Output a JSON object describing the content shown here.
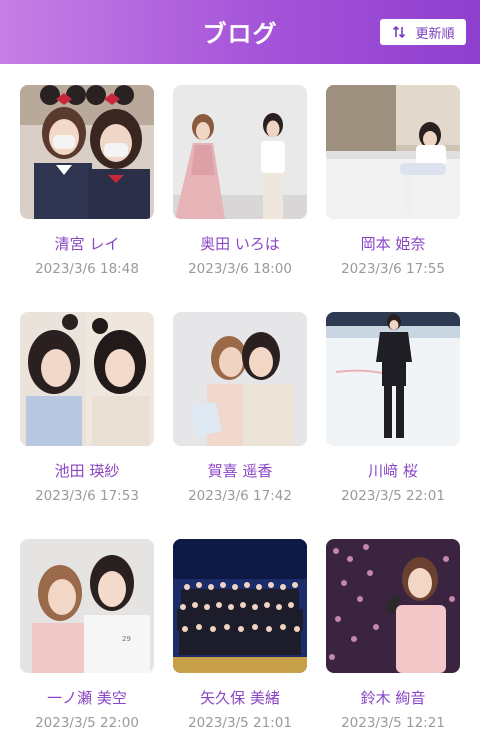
{
  "header": {
    "title": "ブログ",
    "sort_label": "更新順",
    "accent": "#a454d8"
  },
  "posts": [
    {
      "author": "清宮 レイ",
      "date": "2023/3/6 18:48"
    },
    {
      "author": "奥田 いろは",
      "date": "2023/3/6 18:00"
    },
    {
      "author": "岡本 姫奈",
      "date": "2023/3/6 17:55"
    },
    {
      "author": "池田 瑛紗",
      "date": "2023/3/6 17:53"
    },
    {
      "author": "賀喜 遥香",
      "date": "2023/3/6 17:42"
    },
    {
      "author": "川﨑 桜",
      "date": "2023/3/5 22:01"
    },
    {
      "author": "一ノ瀬 美空",
      "date": "2023/3/5 22:00"
    },
    {
      "author": "矢久保 美緒",
      "date": "2023/3/5 21:01"
    },
    {
      "author": "鈴木 絢音",
      "date": "2023/3/5 12:21"
    }
  ]
}
